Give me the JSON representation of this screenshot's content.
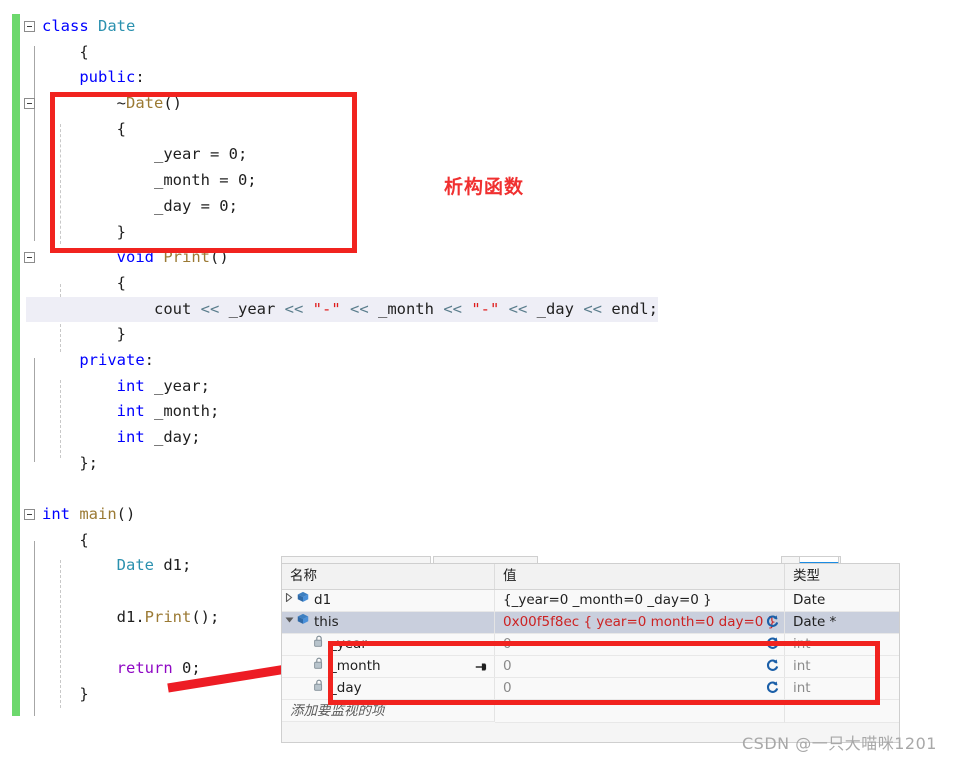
{
  "editor": {
    "lines": [
      {
        "indent": 0,
        "fold": true,
        "tokens": [
          {
            "t": "class ",
            "c": "kw"
          },
          {
            "t": "Date",
            "c": "type"
          }
        ]
      },
      {
        "indent": 1,
        "tokens": [
          {
            "t": "{",
            "c": "pln"
          }
        ]
      },
      {
        "indent": 1,
        "tokens": [
          {
            "t": "public",
            "c": "kw"
          },
          {
            "t": ":",
            "c": "pln"
          }
        ]
      },
      {
        "indent": 2,
        "fold": true,
        "tokens": [
          {
            "t": "~",
            "c": "pln"
          },
          {
            "t": "Date",
            "c": "fn"
          },
          {
            "t": "()",
            "c": "pln"
          }
        ]
      },
      {
        "indent": 2,
        "tokens": [
          {
            "t": "{",
            "c": "pln"
          }
        ]
      },
      {
        "indent": 3,
        "tokens": [
          {
            "t": "_year = 0;",
            "c": "pln"
          }
        ]
      },
      {
        "indent": 3,
        "tokens": [
          {
            "t": "_month = 0;",
            "c": "pln"
          }
        ]
      },
      {
        "indent": 3,
        "tokens": [
          {
            "t": "_day = 0;",
            "c": "pln"
          }
        ]
      },
      {
        "indent": 2,
        "tokens": [
          {
            "t": "}",
            "c": "pln"
          }
        ]
      },
      {
        "indent": 2,
        "fold": true,
        "tokens": [
          {
            "t": "void ",
            "c": "kw"
          },
          {
            "t": "Print",
            "c": "fn"
          },
          {
            "t": "()",
            "c": "pln"
          }
        ]
      },
      {
        "indent": 2,
        "tokens": [
          {
            "t": "{",
            "c": "pln"
          }
        ]
      },
      {
        "indent": 3,
        "highlight": true,
        "tokens": [
          {
            "t": "cout ",
            "c": "pln"
          },
          {
            "t": "<< ",
            "c": "op"
          },
          {
            "t": "_year ",
            "c": "pln"
          },
          {
            "t": "<< ",
            "c": "op"
          },
          {
            "t": "\"-\" ",
            "c": "str"
          },
          {
            "t": "<< ",
            "c": "op"
          },
          {
            "t": "_month ",
            "c": "pln"
          },
          {
            "t": "<< ",
            "c": "op"
          },
          {
            "t": "\"-\" ",
            "c": "str"
          },
          {
            "t": "<< ",
            "c": "op"
          },
          {
            "t": "_day ",
            "c": "pln"
          },
          {
            "t": "<< ",
            "c": "op"
          },
          {
            "t": "endl;",
            "c": "pln"
          }
        ]
      },
      {
        "indent": 2,
        "tokens": [
          {
            "t": "}",
            "c": "pln"
          }
        ]
      },
      {
        "indent": 1,
        "tokens": [
          {
            "t": "private",
            "c": "kw"
          },
          {
            "t": ":",
            "c": "pln"
          }
        ]
      },
      {
        "indent": 2,
        "tokens": [
          {
            "t": "int ",
            "c": "kw"
          },
          {
            "t": "_year;",
            "c": "pln"
          }
        ]
      },
      {
        "indent": 2,
        "tokens": [
          {
            "t": "int ",
            "c": "kw"
          },
          {
            "t": "_month;",
            "c": "pln"
          }
        ]
      },
      {
        "indent": 2,
        "tokens": [
          {
            "t": "int ",
            "c": "kw"
          },
          {
            "t": "_day;",
            "c": "pln"
          }
        ]
      },
      {
        "indent": 1,
        "tokens": [
          {
            "t": "};",
            "c": "pln"
          }
        ]
      },
      {
        "indent": 0,
        "tokens": []
      },
      {
        "indent": 0,
        "fold": true,
        "tokens": [
          {
            "t": "int ",
            "c": "kw"
          },
          {
            "t": "main",
            "c": "fn"
          },
          {
            "t": "()",
            "c": "pln"
          }
        ]
      },
      {
        "indent": 1,
        "tokens": [
          {
            "t": "{",
            "c": "pln"
          }
        ]
      },
      {
        "indent": 2,
        "tokens": [
          {
            "t": "Date",
            "c": "type"
          },
          {
            "t": " d1;",
            "c": "pln"
          }
        ]
      },
      {
        "indent": 0,
        "tokens": []
      },
      {
        "indent": 2,
        "tokens": [
          {
            "t": "d1.",
            "c": "pln"
          },
          {
            "t": "Print",
            "c": "fn"
          },
          {
            "t": "();",
            "c": "pln"
          }
        ]
      },
      {
        "indent": 0,
        "tokens": []
      },
      {
        "indent": 2,
        "tokens": [
          {
            "t": "return ",
            "c": "mac"
          },
          {
            "t": "0;",
            "c": "pln"
          }
        ]
      },
      {
        "indent": 1,
        "tokens": [
          {
            "t": "}",
            "c": "pln"
          }
        ]
      }
    ]
  },
  "annotations": {
    "destructor_label": "析构函数",
    "destructor_box_color": "#f1231f",
    "watch_box_color": "#f1231f",
    "arrow_color": "#ed1c24"
  },
  "watch": {
    "columns": [
      "名称",
      "值",
      "类型"
    ],
    "rows": [
      {
        "expander": "collapsed",
        "depth": 0,
        "icon": "object-icon",
        "name": "d1",
        "value": "{_year=0 _month=0 _day=0 }",
        "type": "Date",
        "selected": false,
        "value_red": false,
        "refresh": false,
        "pin": false
      },
      {
        "expander": "expanded",
        "depth": 0,
        "icon": "object-icon",
        "name": "this",
        "value": "0x00f5f8ec { year=0  month=0  day=0 }",
        "type": "Date *",
        "selected": true,
        "value_red": true,
        "refresh": true,
        "pin": false
      },
      {
        "expander": "none",
        "depth": 1,
        "icon": "field-icon",
        "name": "_year",
        "value": "0",
        "type": "int",
        "selected": false,
        "value_red": false,
        "refresh": true,
        "pin": false
      },
      {
        "expander": "none",
        "depth": 1,
        "icon": "field-icon",
        "name": "_month",
        "value": "0",
        "type": "int",
        "selected": false,
        "value_red": false,
        "refresh": true,
        "pin": true
      },
      {
        "expander": "none",
        "depth": 1,
        "icon": "field-icon",
        "name": "_day",
        "value": "0",
        "type": "int",
        "selected": false,
        "value_red": false,
        "refresh": true,
        "pin": false
      }
    ],
    "add_item_placeholder": "添加要监视的项"
  },
  "watermark": "CSDN @一只大喵咪1201"
}
